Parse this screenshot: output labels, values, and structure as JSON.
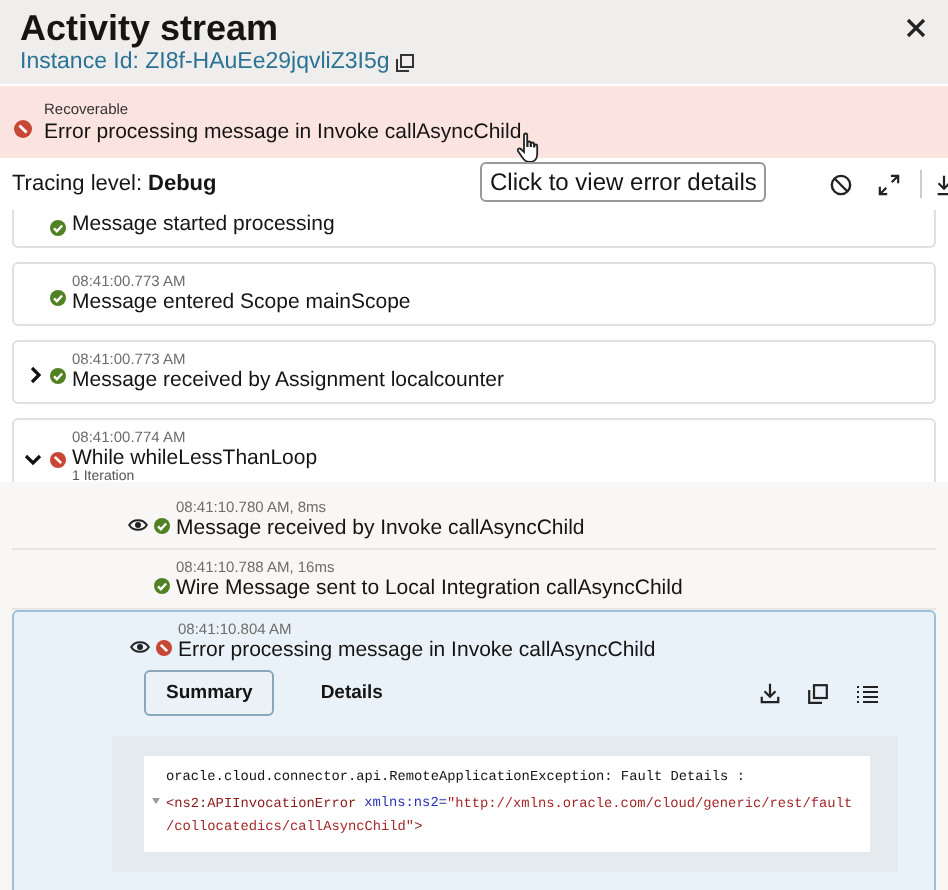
{
  "header": {
    "title": "Activity stream",
    "instance_id": "Instance Id: ZI8f-HAuEe29jqvliZ3I5g"
  },
  "banner": {
    "severity": "Recoverable",
    "message": "Error processing message in Invoke callAsyncChild",
    "failed": true
  },
  "tooltip": "Click to view error details",
  "tracing": {
    "label": "Tracing level:",
    "value": "Debug"
  },
  "events": [
    {
      "message": "Message started processing",
      "failed": false
    },
    {
      "time": "08:41:00.773 AM",
      "message": "Message entered Scope mainScope",
      "failed": false
    },
    {
      "time": "08:41:00.773 AM",
      "message": "Message received by Assignment localcounter",
      "failed": false,
      "expanded": false
    },
    {
      "time": "08:41:00.774 AM",
      "message": "While whileLessThanLoop",
      "failed": true,
      "expanded": true,
      "note": "1 Iteration",
      "children": [
        {
          "time": "08:41:10.780 AM, 8ms",
          "message": "Message received by Invoke callAsyncChild",
          "failed": false,
          "viewable": true,
          "selected": false
        },
        {
          "time": "08:41:10.788 AM, 16ms",
          "message": "Wire Message sent to Local Integration callAsyncChild",
          "failed": false,
          "viewable": false,
          "selected": false
        },
        {
          "time": "08:41:10.804 AM",
          "message": "Error processing message in Invoke callAsyncChild",
          "failed": true,
          "viewable": true,
          "selected": true,
          "details": {
            "tabs": [
              {
                "label": "Summary",
                "selected": true
              },
              {
                "label": "Details",
                "selected": false
              }
            ],
            "code_lines": [
              {
                "folded": false,
                "tokens": [
                  {
                    "kind": "text",
                    "text": "oracle.cloud.connector.api.RemoteApplicationException: Fault Details :"
                  }
                ]
              },
              {
                "folded": true,
                "tokens": [
                  {
                    "kind": "tag",
                    "text": "<ns2:APIInvocationError"
                  },
                  {
                    "kind": "attr",
                    "text": "xmlns:ns2="
                  },
                  {
                    "kind": "string",
                    "text": "\"http://xmlns.oracle.com/cloud/generic/rest/fault"
                  }
                ]
              },
              {
                "folded": false,
                "tokens": [
                  {
                    "kind": "string",
                    "text": "/collocatedics/callAsyncChild\""
                  },
                  {
                    "kind": "tag",
                    "text": ">"
                  }
                ]
              }
            ]
          }
        }
      ]
    }
  ]
}
